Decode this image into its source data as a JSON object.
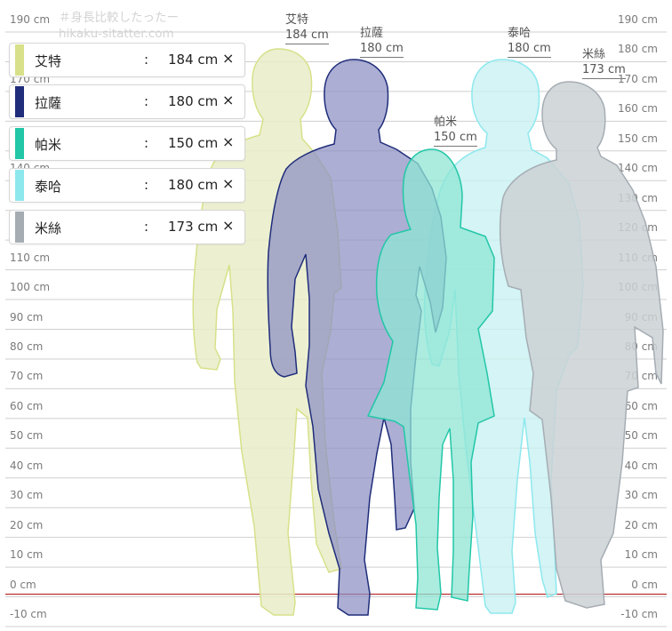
{
  "watermark": {
    "line1": "＃身長比較したったー",
    "line2": "hikaku-sitatter.com"
  },
  "ticks": [
    "190 cm",
    "180 cm",
    "170 cm",
    "160 cm",
    "150 cm",
    "140 cm",
    "130 cm",
    "120 cm",
    "110 cm",
    "100 cm",
    "90 cm",
    "80 cm",
    "70 cm",
    "60 cm",
    "50 cm",
    "40 cm",
    "30 cm",
    "20 cm",
    "10 cm",
    "0 cm",
    "-10 cm"
  ],
  "characters": [
    {
      "name": "艾特",
      "height": "184 cm",
      "height_cm": 184,
      "color": "#d8e08a",
      "fill": "#e9edc8"
    },
    {
      "name": "拉薩",
      "height": "180 cm",
      "height_cm": 180,
      "color": "#1f2d7a",
      "fill": "#8c8fc4"
    },
    {
      "name": "帕米",
      "height": "150 cm",
      "height_cm": 150,
      "color": "#22c7a7",
      "fill": "#8fe5d4"
    },
    {
      "name": "泰哈",
      "height": "180 cm",
      "height_cm": 180,
      "color": "#8de8ee",
      "fill": "#c9f1f3"
    },
    {
      "name": "米絲",
      "height": "173 cm",
      "height_cm": 173,
      "color": "#a5adb3",
      "fill": "#cbd1d5"
    }
  ],
  "legend_colon": ":",
  "legend_remove": "×",
  "colors": {
    "grid": "#cfcfcf",
    "baseline": "#b22222"
  }
}
